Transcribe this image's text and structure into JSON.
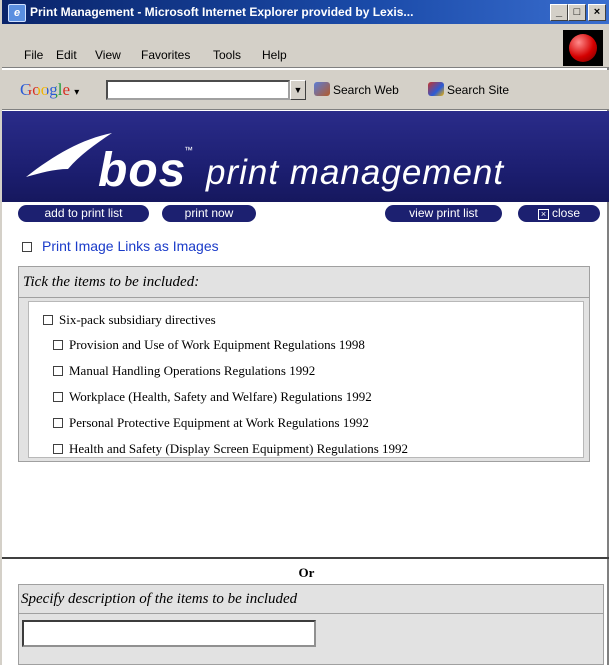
{
  "window": {
    "title": "Print Management - Microsoft Internet Explorer provided by Lexis...",
    "minimize": "_",
    "maximize": "□",
    "close": "×"
  },
  "menu": {
    "file": "File",
    "edit": "Edit",
    "view": "View",
    "favorites": "Favorites",
    "tools": "Tools",
    "help": "Help"
  },
  "google_toolbar": {
    "logo": "Google",
    "logo_arrow": "▾",
    "search_value": "",
    "dropdown_arrow": "▼",
    "search_web": "Search Web",
    "search_site": "Search Site"
  },
  "banner": {
    "brand": "bos",
    "trademark": "™",
    "subtitle": "print management"
  },
  "toolbar": {
    "add": "add to print list",
    "print": "print now",
    "view": "view print list",
    "close": "close"
  },
  "option": {
    "label": "Print Image Links as Images",
    "checked": false
  },
  "items_section": {
    "legend": "Tick the items to be included:",
    "parent": {
      "label": "Six-pack subsidiary directives",
      "checked": false
    },
    "children": [
      {
        "label": "Provision and Use of Work Equipment Regulations 1998",
        "checked": false
      },
      {
        "label": "Manual Handling Operations Regulations 1992",
        "checked": false
      },
      {
        "label": "Workplace (Health, Safety and Welfare) Regulations 1992",
        "checked": false
      },
      {
        "label": "Personal Protective Equipment at Work Regulations 1992",
        "checked": false
      },
      {
        "label": "Health and Safety (Display Screen Equipment) Regulations 1992",
        "checked": false
      }
    ]
  },
  "or_text": "Or",
  "description_section": {
    "legend": "Specify description of the items to be included",
    "value": ""
  }
}
